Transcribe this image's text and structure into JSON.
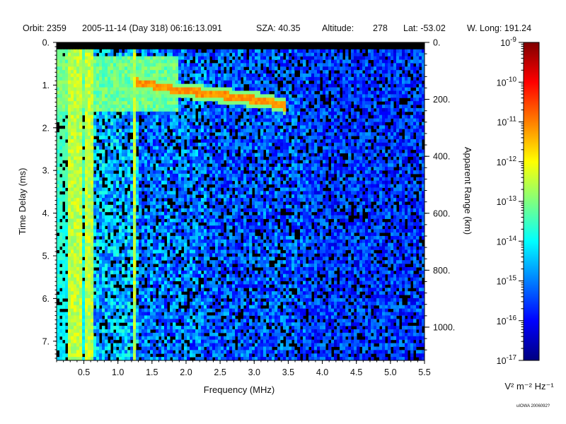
{
  "header": {
    "orbit": "Orbit: 2359",
    "datetime": "2005-11-14 (Day 318) 06:16:13.091",
    "sza": "SZA:  40.35",
    "altitude_label": "Altitude:",
    "altitude_value": "278",
    "lat": "Lat: -53.02",
    "wlong": "W. Long: 191.24"
  },
  "credit": "uIOWA 2006092?",
  "colors": {
    "colormap": [
      "#00007f",
      "#0000ff",
      "#007fff",
      "#00ffff",
      "#7fff7f",
      "#ffff00",
      "#ff7f00",
      "#ff0000",
      "#7f0000"
    ],
    "no_data": "#000000"
  },
  "chart_data": [
    {
      "type": "heatmap",
      "title": "",
      "xlabel": "Frequency (MHz)",
      "ylabel": "Time Delay (ms)",
      "y2label": "Apparent Range (km)",
      "xlim": [
        0.1,
        5.5
      ],
      "ylim": [
        0.0,
        7.45
      ],
      "y_inverted": true,
      "grid": false,
      "x_ticks": [
        0.5,
        1.0,
        1.5,
        2.0,
        2.5,
        3.0,
        3.5,
        4.0,
        4.5,
        5.0,
        5.5
      ],
      "x_tick_labels": [
        "0.5",
        "1.0",
        "1.5",
        "2.0",
        "2.5",
        "3.0",
        "3.5",
        "4.0",
        "4.5",
        "5.0",
        "5.5"
      ],
      "y_ticks": [
        0,
        1,
        2,
        3,
        4,
        5,
        6,
        7
      ],
      "y_tick_labels": [
        "0.",
        "1.",
        "2.",
        "3.",
        "4.",
        "5.",
        "6.",
        "7."
      ],
      "y2_ticks_km": [
        0,
        200,
        400,
        600,
        800,
        1000
      ],
      "y2_tick_labels": [
        "0.",
        "200.",
        "400.",
        "600.",
        "800.",
        "1000."
      ],
      "km_per_ms": 149.9,
      "features": {
        "local_plasma_harmonics_mhz": [
          0.28,
          0.33,
          0.38,
          0.43,
          0.47,
          0.52,
          0.56,
          0.62,
          1.24
        ],
        "ionospheric_echo_trace": [
          {
            "freq": 1.25,
            "delay": 0.92
          },
          {
            "freq": 1.5,
            "delay": 1.0
          },
          {
            "freq": 1.8,
            "delay": 1.1
          },
          {
            "freq": 2.1,
            "delay": 1.16
          },
          {
            "freq": 2.4,
            "delay": 1.22
          },
          {
            "freq": 2.8,
            "delay": 1.3
          },
          {
            "freq": 3.2,
            "delay": 1.38
          },
          {
            "freq": 3.45,
            "delay": 1.5
          }
        ],
        "ground_echo": {
          "freq_max": 1.9,
          "delay_min": 0.35
        }
      }
    },
    {
      "type": "heatmap",
      "title": "",
      "units_label": "V² m⁻² Hz⁻¹",
      "log_scale": true,
      "range_exp": [
        -17,
        -9
      ],
      "tick_exponents": [
        -9,
        -10,
        -11,
        -12,
        -13,
        -14,
        -15,
        -16,
        -17
      ]
    }
  ]
}
